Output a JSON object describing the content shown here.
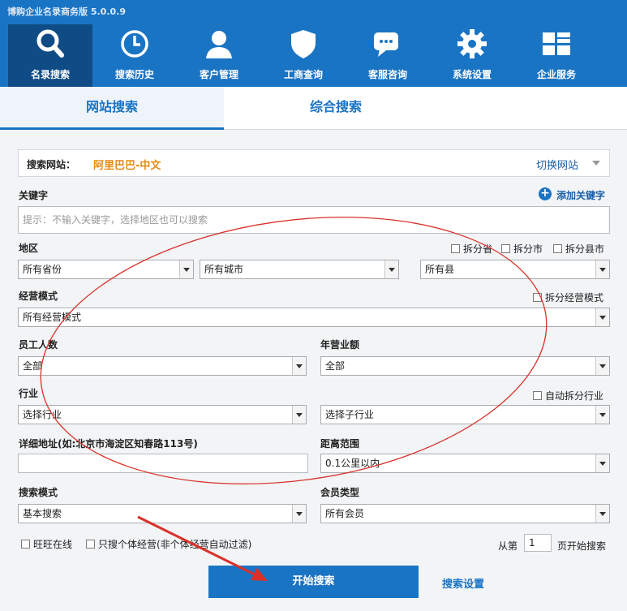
{
  "app": {
    "title": "博购企业名录商务版 5.0.0.9"
  },
  "nav": [
    {
      "label": "名录搜索",
      "icon": "search-icon"
    },
    {
      "label": "搜索历史",
      "icon": "clock-icon"
    },
    {
      "label": "客户管理",
      "icon": "user-icon"
    },
    {
      "label": "工商查询",
      "icon": "shield-icon"
    },
    {
      "label": "客服咨询",
      "icon": "chat-icon"
    },
    {
      "label": "系统设置",
      "icon": "gear-icon"
    },
    {
      "label": "企业服务",
      "icon": "grid-icon"
    }
  ],
  "tabs": [
    "网站搜索",
    "综合搜索"
  ],
  "site": {
    "label": "搜索网站：",
    "value": "阿里巴巴-中文",
    "switch": "切换网站"
  },
  "colors": {
    "accent": "#1a74c4",
    "highlight": "#e58a14",
    "annotation": "#d9312a"
  },
  "keyword": {
    "label": "关键字",
    "add": "添加关键字",
    "placeholder": "提示：不输入关键字，选择地区也可以搜索"
  },
  "region": {
    "label": "地区",
    "split_province": "拆分省",
    "split_city": "拆分市",
    "split_county": "拆分县市",
    "province": "所有省份",
    "city": "所有城市",
    "county": "所有县"
  },
  "mode": {
    "label": "经营模式",
    "split": "拆分经营模式",
    "value": "所有经营模式"
  },
  "staff": {
    "label": "员工人数",
    "value": "全部"
  },
  "revenue": {
    "label": "年营业额",
    "value": "全部"
  },
  "industry": {
    "label": "行业",
    "auto_split": "自动拆分行业",
    "value": "选择行业",
    "sub": "选择子行业"
  },
  "address": {
    "label": "详细地址(如:北京市海淀区知春路113号)",
    "value": ""
  },
  "distance": {
    "label": "距离范围",
    "value": "0.1公里以内"
  },
  "search_mode": {
    "label": "搜索模式",
    "value": "基本搜索"
  },
  "member": {
    "label": "会员类型",
    "value": "所有会员"
  },
  "options": {
    "wangwang": "旺旺在线",
    "individual": "只搜个体经营(非个体经营自动过滤)"
  },
  "paging": {
    "prefix": "从第",
    "page": "1",
    "suffix": "页开始搜索"
  },
  "actions": {
    "start": "开始搜索",
    "settings": "搜索设置"
  }
}
